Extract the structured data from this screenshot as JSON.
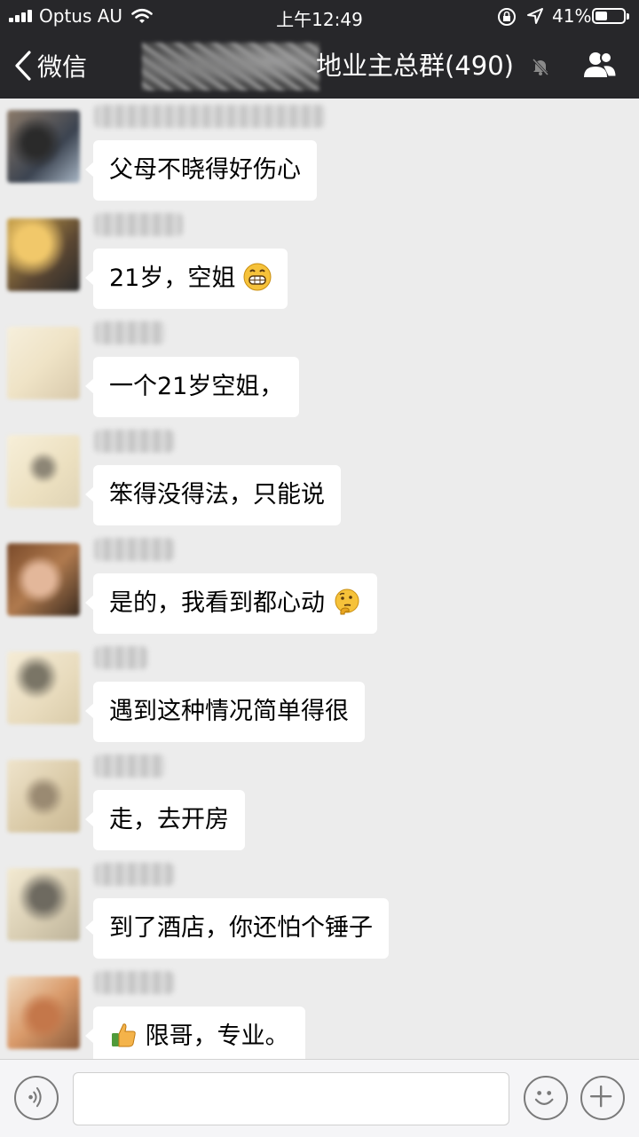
{
  "status_bar": {
    "carrier": "Optus AU",
    "time": "上午12:49",
    "battery": "41%"
  },
  "nav": {
    "back_label": "微信",
    "title": "地业主总群(490)"
  },
  "messages": [
    {
      "text": "父母不晓得好伤心",
      "emoji": ""
    },
    {
      "text": "21岁，空姐",
      "emoji": "grin-emoji"
    },
    {
      "text": "一个21岁空姐，",
      "emoji": ""
    },
    {
      "text": "笨得没得法，只能说",
      "emoji": ""
    },
    {
      "text": "是的，我看到都心动",
      "emoji": "thinking-emoji"
    },
    {
      "text": "遇到这种情况简单得很",
      "emoji": ""
    },
    {
      "text": "走，去开房",
      "emoji": ""
    },
    {
      "text": "到了酒店，你还怕个锤子",
      "emoji": ""
    },
    {
      "text": "限哥，专业。",
      "emoji": "thumbs-up-emoji"
    }
  ],
  "input": {
    "value": "",
    "placeholder": ""
  },
  "colors": {
    "header_bg": "#27272a",
    "chat_bg": "#ececec",
    "bubble_bg": "#ffffff"
  }
}
